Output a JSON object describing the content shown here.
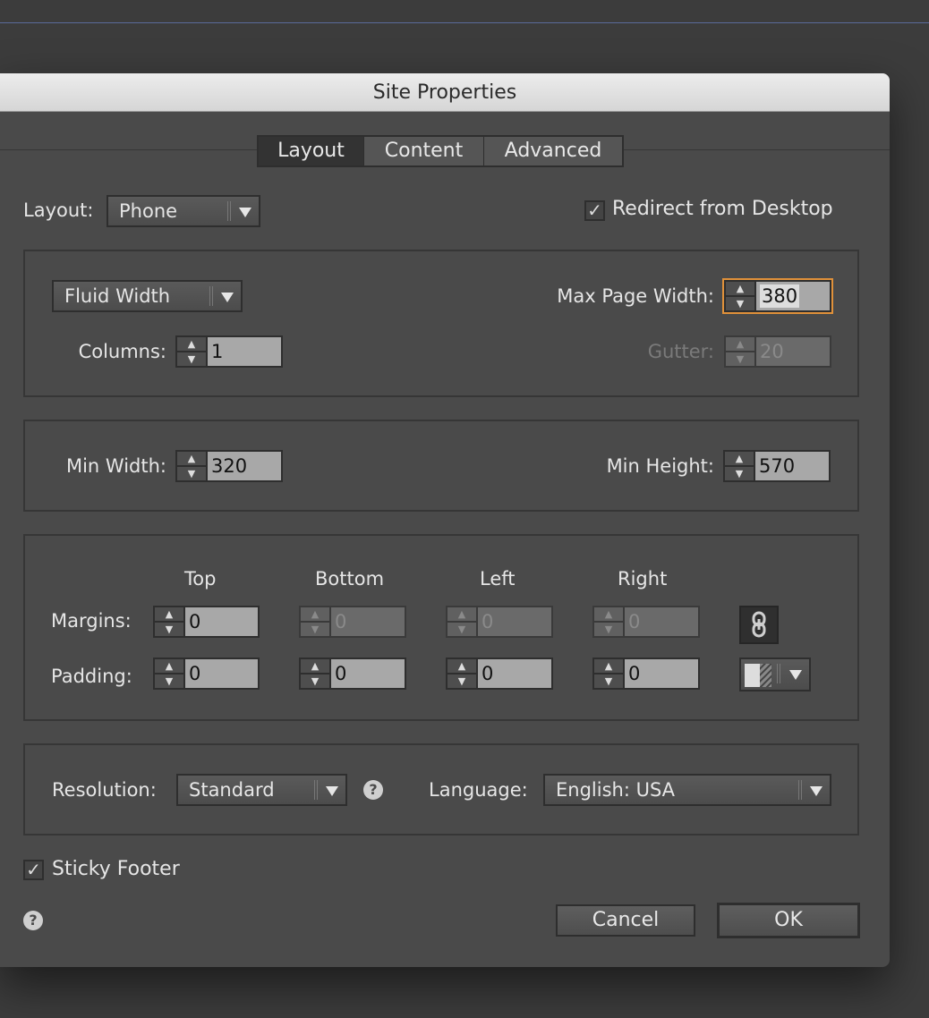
{
  "dialog": {
    "title": "Site Properties"
  },
  "tabs": [
    {
      "label": "Layout",
      "active": true
    },
    {
      "label": "Content"
    },
    {
      "label": "Advanced"
    }
  ],
  "layout": {
    "label": "Layout:",
    "value": "Phone"
  },
  "redirect": {
    "label": "Redirect from Desktop",
    "checked": true
  },
  "width_panel": {
    "mode": "Fluid Width",
    "max_page_width_label": "Max Page Width:",
    "max_page_width": "380",
    "columns_label": "Columns:",
    "columns": "1",
    "gutter_label": "Gutter:",
    "gutter": "20"
  },
  "size_panel": {
    "min_width_label": "Min Width:",
    "min_width": "320",
    "min_height_label": "Min Height:",
    "min_height": "570"
  },
  "spacing": {
    "headers": [
      "Top",
      "Bottom",
      "Left",
      "Right"
    ],
    "margins_label": "Margins:",
    "margins": [
      "0",
      "0",
      "0",
      "0"
    ],
    "padding_label": "Padding:",
    "padding": [
      "0",
      "0",
      "0",
      "0"
    ],
    "link_icon": "chain-link-icon",
    "swatch_icon": "fill-swatch-icon"
  },
  "misc": {
    "resolution_label": "Resolution:",
    "resolution": "Standard",
    "language_label": "Language:",
    "language": "English: USA"
  },
  "sticky_footer": {
    "label": "Sticky Footer",
    "checked": true
  },
  "buttons": {
    "cancel": "Cancel",
    "ok": "OK"
  },
  "colors": {
    "focus_border": "#e0913a",
    "dialog_bg": "#4a4a4a"
  }
}
